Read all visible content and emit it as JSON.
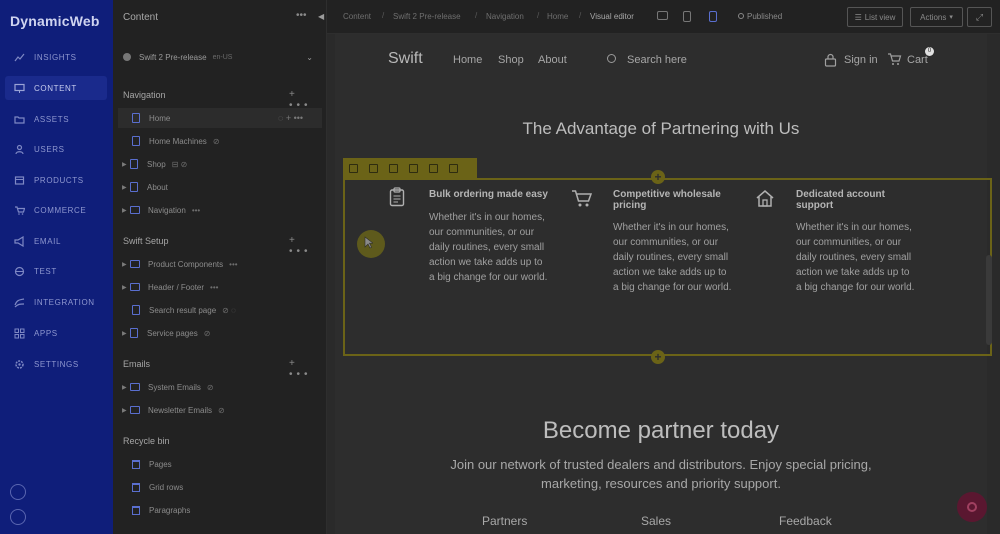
{
  "app": {
    "brand": "DynamicWeb"
  },
  "rail": {
    "items": [
      {
        "label": "INSIGHTS",
        "icon": "chart-icon"
      },
      {
        "label": "CONTENT",
        "icon": "monitor-icon"
      },
      {
        "label": "ASSETS",
        "icon": "folder-icon"
      },
      {
        "label": "USERS",
        "icon": "user-icon"
      },
      {
        "label": "PRODUCTS",
        "icon": "box-icon"
      },
      {
        "label": "COMMERCE",
        "icon": "cart-icon"
      },
      {
        "label": "EMAIL",
        "icon": "megaphone-icon"
      },
      {
        "label": "TEST",
        "icon": "globe-icon"
      },
      {
        "label": "INTEGRATION",
        "icon": "integration-icon"
      },
      {
        "label": "APPS",
        "icon": "apps-icon"
      },
      {
        "label": "SETTINGS",
        "icon": "gear-icon"
      }
    ]
  },
  "tree": {
    "title": "Content",
    "site": "Swift 2 Pre-release",
    "site_suffix": "en-US",
    "sections": {
      "navigation": "Navigation",
      "swift_setup": "Swift Setup",
      "emails": "Emails",
      "recycle_bin": "Recycle bin"
    },
    "navigation": [
      {
        "label": "Home"
      },
      {
        "label": "Home Machines"
      },
      {
        "label": "Shop"
      },
      {
        "label": "About"
      },
      {
        "label": "Navigation"
      }
    ],
    "swift_setup": [
      {
        "label": "Product Components"
      },
      {
        "label": "Header / Footer"
      },
      {
        "label": "Search result page"
      },
      {
        "label": "Service pages"
      }
    ],
    "emails": [
      {
        "label": "System Emails"
      },
      {
        "label": "Newsletter Emails"
      }
    ],
    "recycle_bin": [
      {
        "label": "Pages"
      },
      {
        "label": "Grid rows"
      },
      {
        "label": "Paragraphs"
      }
    ]
  },
  "topbar": {
    "breadcrumbs": [
      "Content",
      "Swift 2 Pre-release",
      "Navigation",
      "Home",
      "Visual editor"
    ],
    "status": "Published",
    "list_view": "List view",
    "actions": "Actions"
  },
  "site": {
    "logo": "Swift",
    "nav": [
      "Home",
      "Shop",
      "About"
    ],
    "search_placeholder": "Search here",
    "sign_in": "Sign in",
    "cart": "Cart",
    "cart_count": "0",
    "advantage_title": "The Advantage of Partnering with Us",
    "features": [
      {
        "title": "Bulk ordering made easy",
        "body": [
          "Whether it's in our homes,",
          "our communities, or our",
          "daily routines, every small",
          "action we take adds up to",
          "a big change for our world."
        ]
      },
      {
        "title": "Competitive wholesale",
        "title2": "pricing",
        "body": [
          "Whether it's in our homes,",
          "our communities, or our",
          "daily routines, every small",
          "action we take adds up to",
          "a big change for our world."
        ]
      },
      {
        "title": "Dedicated account",
        "title2": "support",
        "body": [
          "Whether it's in our homes,",
          "our communities, or our",
          "daily routines, every small",
          "action we take adds up to",
          "a big change for our world."
        ]
      }
    ],
    "partner_title": "Become partner today",
    "partner_sub": [
      "Join our network of trusted dealers and distributors. Enjoy special pricing,",
      "marketing, resources and priority support."
    ],
    "columns": [
      "Partners",
      "Sales",
      "Feedback"
    ]
  }
}
